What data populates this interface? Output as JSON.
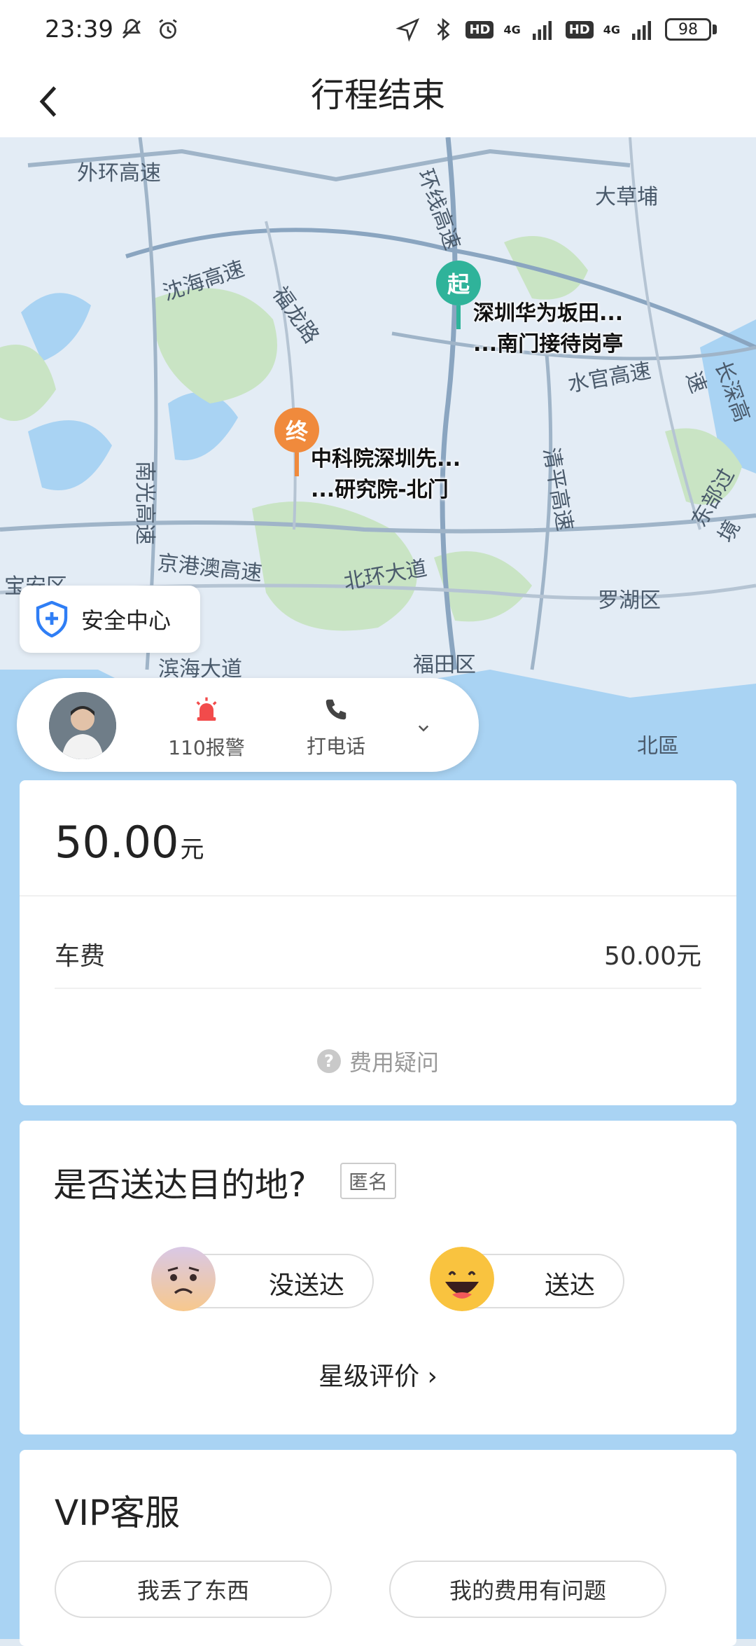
{
  "status_bar": {
    "time": "23:39",
    "network_1": "HD",
    "network_2": "HD",
    "signal_label_1": "4G",
    "signal_label_2": "4G",
    "battery": "98"
  },
  "header": {
    "title": "行程结束"
  },
  "map": {
    "labels": {
      "outer_ring": "外环高速",
      "yanhai": "沈海高速",
      "fulong": "福龙路",
      "ring_line": "环线高速",
      "dacaopu": "大草埔",
      "shuiguan": "水官高速",
      "changshen": "长深高速",
      "nanguang": "南光高速",
      "qingping": "清平高速",
      "jinggangao": "京港澳高速",
      "beihuan": "北环大道",
      "luohu": "罗湖区",
      "baoan": "宝安区",
      "binhai": "滨海大道",
      "futian": "福田区",
      "beiqu": "北區",
      "dongbu": "东部过境"
    },
    "start_pin": "起",
    "end_pin": "终",
    "start_place_line1": "深圳华为坂田...",
    "start_place_line2": "...南门接待岗亭",
    "end_place_line1": "中科院深圳先...",
    "end_place_line2": "...研究院-北门"
  },
  "safety_center": "安全中心",
  "driver_bar": {
    "alarm_label": "110报警",
    "call_label": "打电话"
  },
  "fare": {
    "total": "50.00",
    "total_unit": "元",
    "item_label": "车费",
    "item_value": "50.00元",
    "question": "费用疑问"
  },
  "arrival": {
    "title": "是否送达目的地?",
    "anonymous": "匿名",
    "not_delivered": "没送达",
    "delivered": "送达",
    "rating": "星级评价 ›"
  },
  "vip": {
    "title": "VIP客服",
    "lost_item": "我丢了东西",
    "fee_problem": "我的费用有问题"
  },
  "colors": {
    "start_pin": "#2fb39a",
    "end_pin": "#f08a3c",
    "map_water": "#a9d3f3",
    "map_land": "#e3ecf5",
    "map_green": "#c9e4c4"
  }
}
